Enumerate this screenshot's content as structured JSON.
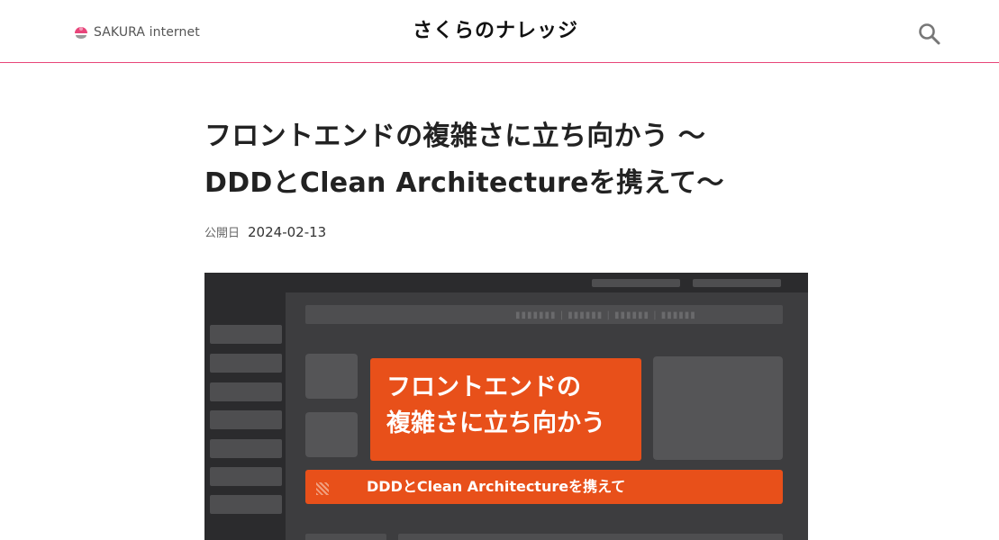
{
  "header": {
    "brand_text": "SAKURA internet",
    "brand_logo_icon": "sakura-logo-icon",
    "site_title": "さくらのナレッジ",
    "search_icon": "search-icon",
    "accent_color": "#e8457a"
  },
  "article": {
    "title_line1": "フロントエンドの複雑さに立ち向かう 〜",
    "title_line2": "DDDとClean Architectureを携えて〜",
    "published_label": "公開日",
    "published_date": "2024-02-13"
  },
  "hero": {
    "headline_line1": "フロントエンドの",
    "headline_line2": "複雑さに立ち向かう",
    "subtitle": "DDDとClean Architectureを携えて",
    "accent_color": "#e8501a"
  }
}
